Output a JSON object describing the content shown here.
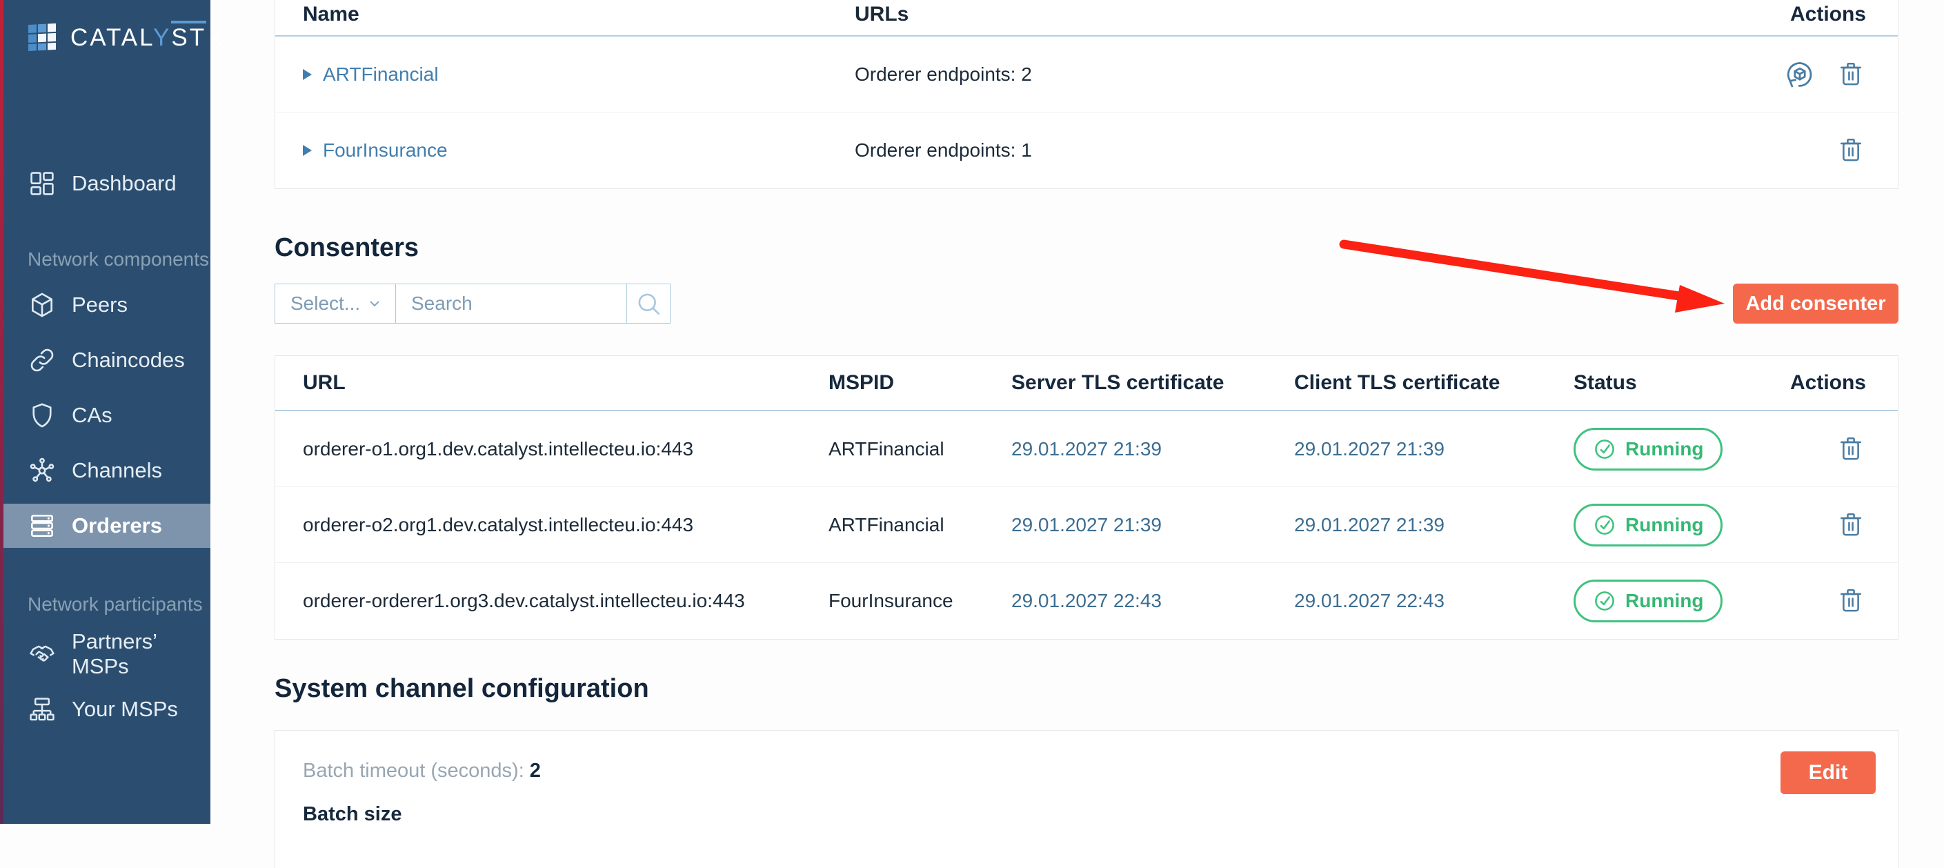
{
  "colors": {
    "accent": "#f4694c",
    "arrow_red": "#fb2113",
    "status_running_green": "#3ec27e",
    "link_blue": "#417eae",
    "sidebar_navy": "#2b4e70"
  },
  "sidebar": {
    "logo": {
      "prefix": "CATAL",
      "mid": "Y",
      "suffix": "ST"
    },
    "nav_top": [
      {
        "label": "Dashboard",
        "icon": "dashboard-icon"
      }
    ],
    "sections": [
      {
        "label": "Network components",
        "items": [
          {
            "label": "Peers",
            "icon": "peers-cube-icon"
          },
          {
            "label": "Chaincodes",
            "icon": "chaincodes-link-icon"
          },
          {
            "label": "CAs",
            "icon": "cas-shield-icon"
          },
          {
            "label": "Channels",
            "icon": "channels-hub-icon"
          },
          {
            "label": "Orderers",
            "icon": "orderers-server-icon",
            "active": true
          }
        ]
      },
      {
        "label": "Network participants",
        "items": [
          {
            "label": "Partners’ MSPs",
            "icon": "partners-handshake-icon"
          },
          {
            "label": "Your MSPs",
            "icon": "your-msps-orgchart-icon"
          }
        ]
      }
    ]
  },
  "orderers_table": {
    "headers": {
      "name": "Name",
      "urls": "URLs",
      "actions": "Actions"
    },
    "rows": [
      {
        "name": "ARTFinancial",
        "urls": "Orderer endpoints: 2",
        "actions": [
          "redeploy",
          "delete"
        ]
      },
      {
        "name": "FourInsurance",
        "urls": "Orderer endpoints: 1",
        "actions": [
          "delete"
        ]
      }
    ]
  },
  "consenters": {
    "title": "Consenters",
    "select_placeholder": "Select...",
    "search_placeholder": "Search",
    "add_button_label": "Add consenter",
    "table": {
      "headers": {
        "url": "URL",
        "mspid": "MSPID",
        "server": "Server TLS certificate",
        "client": "Client TLS certificate",
        "status": "Status",
        "actions": "Actions"
      },
      "rows": [
        {
          "url": "orderer-o1.org1.dev.catalyst.intellecteu.io:443",
          "mspid": "ARTFinancial",
          "server_cert": "29.01.2027 21:39",
          "client_cert": "29.01.2027 21:39",
          "status": "Running"
        },
        {
          "url": "orderer-o2.org1.dev.catalyst.intellecteu.io:443",
          "mspid": "ARTFinancial",
          "server_cert": "29.01.2027 21:39",
          "client_cert": "29.01.2027 21:39",
          "status": "Running"
        },
        {
          "url": "orderer-orderer1.org3.dev.catalyst.intellecteu.io:443",
          "mspid": "FourInsurance",
          "server_cert": "29.01.2027 22:43",
          "client_cert": "29.01.2027 22:43",
          "status": "Running"
        }
      ]
    }
  },
  "system_channel": {
    "title": "System channel configuration",
    "batch_timeout_label": "Batch timeout (seconds):",
    "batch_timeout_value": "2",
    "batch_size_label": "Batch size",
    "edit_button_label": "Edit"
  }
}
